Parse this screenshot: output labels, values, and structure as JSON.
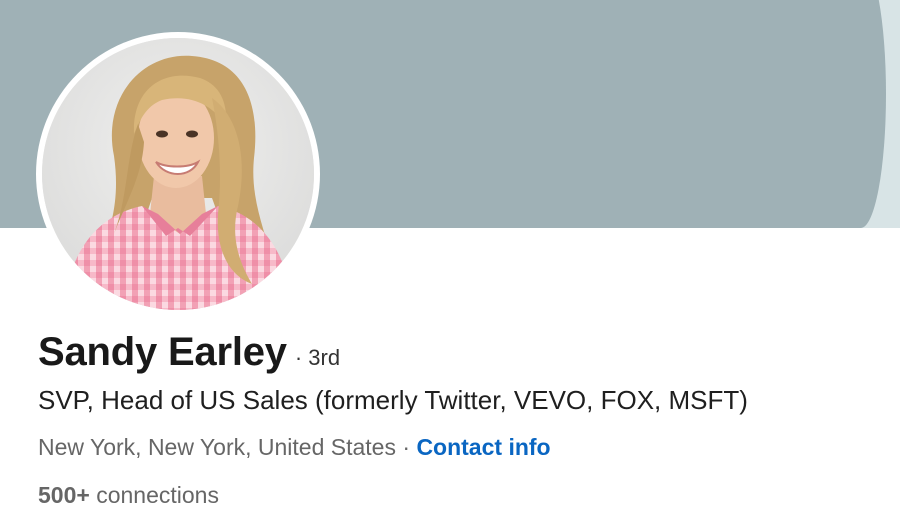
{
  "colors": {
    "cover_primary": "#9fb1b6",
    "cover_secondary": "#d8e4e6",
    "link": "#0a66c2",
    "name_text": "#191919",
    "secondary_text": "#666666"
  },
  "profile": {
    "name": "Sandy Earley",
    "degree": "· 3rd",
    "headline": "SVP, Head of US Sales (formerly Twitter, VEVO, FOX, MSFT)",
    "location": "New York, New York, United States",
    "separator": "·",
    "contact_label": "Contact info",
    "connections_count": "500+",
    "connections_label": "connections"
  }
}
